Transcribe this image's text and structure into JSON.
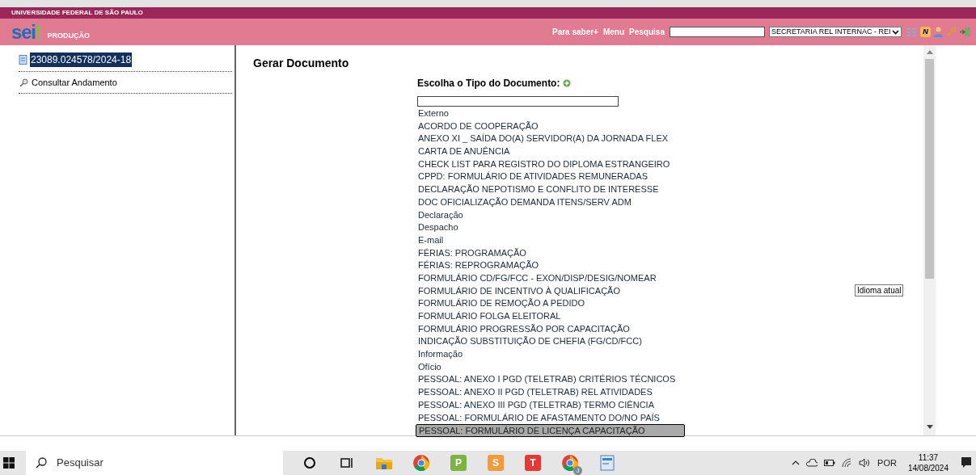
{
  "header": {
    "institution": "UNIVERSIDADE FEDERAL DE SÃO PAULO",
    "logo": "sei",
    "logo_mark": "!",
    "environment": "PRODUÇÃO",
    "links": [
      "Para saber+",
      "Menu",
      "Pesquisa"
    ],
    "unit_select": "SECRETARIA REL INTERNAC - REI",
    "notes_badge": "N"
  },
  "sidebar": {
    "process": {
      "number": "23089.024578/2024-18",
      "selected": true
    },
    "items": [
      "Consultar Andamento"
    ]
  },
  "main": {
    "title": "Gerar Documento",
    "prompt": "Escolha o Tipo do Documento:",
    "options": [
      {
        "label": "Externo",
        "selected": false
      },
      {
        "label": "ACORDO DE COOPERAÇÃO",
        "selected": false
      },
      {
        "label": "ANEXO XI _ SAÍDA DO(A) SERVIDOR(A) DA JORNADA FLEX",
        "selected": false
      },
      {
        "label": "CARTA DE ANUÊNCIA",
        "selected": false
      },
      {
        "label": "CHECK LIST PARA REGISTRO DO DIPLOMA ESTRANGEIRO",
        "selected": false
      },
      {
        "label": "CPPD: FORMULÁRIO DE ATIVIDADES REMUNERADAS",
        "selected": false
      },
      {
        "label": "DECLARAÇÃO NEPOTISMO E CONFLITO DE INTERESSE",
        "selected": false
      },
      {
        "label": "DOC OFICIALIZAÇÃO DEMANDA ITENS/SERV ADM",
        "selected": false
      },
      {
        "label": "Declaração",
        "selected": false
      },
      {
        "label": "Despacho",
        "selected": false
      },
      {
        "label": "E-mail",
        "selected": false
      },
      {
        "label": "FÉRIAS: PROGRAMAÇÃO",
        "selected": false
      },
      {
        "label": "FÉRIAS: REPROGRAMAÇÃO",
        "selected": false
      },
      {
        "label": "FORMULÁRIO CD/FG/FCC - EXON/DISP/DESIG/NOMEAR",
        "selected": false
      },
      {
        "label": "FORMULÁRIO DE INCENTIVO À QUALIFICAÇÃO",
        "selected": false
      },
      {
        "label": "FORMULÁRIO DE REMOÇÃO A PEDIDO",
        "selected": false
      },
      {
        "label": "FORMULÁRIO FOLGA ELEITORAL",
        "selected": false
      },
      {
        "label": "FORMULÁRIO PROGRESSÃO POR CAPACITAÇÃO",
        "selected": false
      },
      {
        "label": "INDICAÇÃO SUBSTITUIÇÃO DE CHEFIA (FG/CD/FCC)",
        "selected": false
      },
      {
        "label": "Informação",
        "selected": false
      },
      {
        "label": "Ofício",
        "selected": false
      },
      {
        "label": "PESSOAL: ANEXO I PGD (TELETRAB) CRITÉRIOS TÉCNICOS",
        "selected": false
      },
      {
        "label": "PESSOAL: ANEXO II PGD (TELETRAB) REL ATIVIDADES",
        "selected": false
      },
      {
        "label": "PESSOAL: ANEXO III PGD (TELETRAB) TERMO CIÊNCIA",
        "selected": false
      },
      {
        "label": "PESSOAL: FORMULÁRIO DE AFASTAMENTO DO/NO PAÍS",
        "selected": false
      },
      {
        "label": "PESSOAL: FORMULÁRIO DE LICENÇA CAPACITAÇÃO",
        "selected": true
      }
    ],
    "tooltip": "Idioma atual"
  },
  "taskbar": {
    "search_placeholder": "Pesquisar",
    "apps": [
      {
        "kind": "cortana"
      },
      {
        "kind": "taskview"
      },
      {
        "kind": "folder"
      },
      {
        "kind": "chrome"
      },
      {
        "kind": "letter",
        "label": "P",
        "color": "#7cb342"
      },
      {
        "kind": "letter",
        "label": "S",
        "color": "#f39a3d"
      },
      {
        "kind": "letter",
        "label": "T",
        "color": "#e53935"
      },
      {
        "kind": "chrome_profile",
        "label": "J"
      },
      {
        "kind": "document"
      }
    ],
    "language": "POR",
    "time": "11:37",
    "date": "14/08/2024"
  }
}
